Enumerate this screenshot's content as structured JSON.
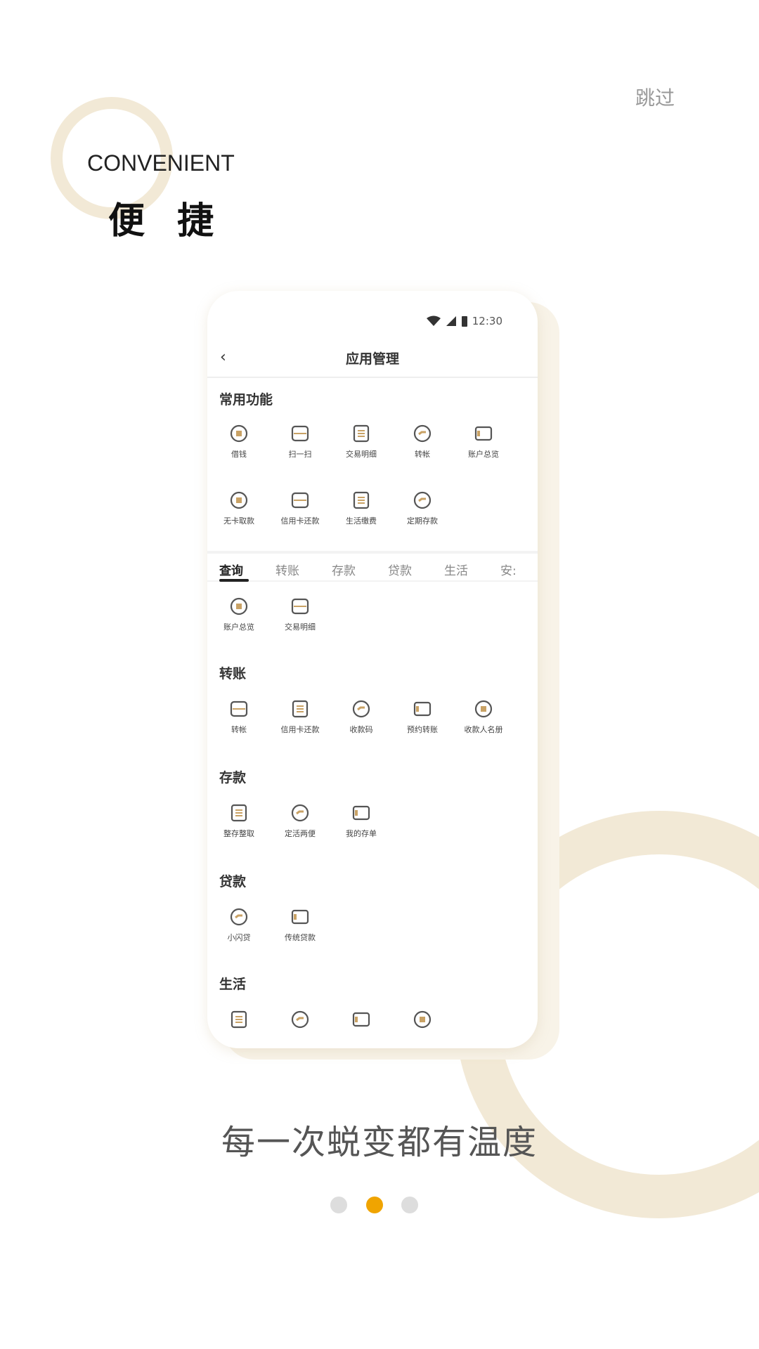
{
  "skip_label": "跳过",
  "heading_en": "CONVENIENT",
  "heading_cn": "便 捷",
  "tagline": "每一次蜕变都有温度",
  "pagination": {
    "total": 3,
    "active": 2
  },
  "colors": {
    "accent": "#f0a400",
    "ring": "#f2e9d6",
    "icon_gold": "#c9a265"
  },
  "phone": {
    "time": "12:30",
    "title": "应用管理",
    "common": {
      "title": "常用功能",
      "items": [
        "借钱",
        "扫一扫",
        "交易明细",
        "转帐",
        "账户总览",
        "无卡取款",
        "信用卡还款",
        "生活缴费",
        "定期存款"
      ]
    },
    "tabs": [
      "查询",
      "转账",
      "存款",
      "贷款",
      "生活",
      "安:"
    ],
    "sections": [
      {
        "title": "",
        "items": [
          "账户总览",
          "交易明细"
        ]
      },
      {
        "title": "转账",
        "items": [
          "转帐",
          "信用卡还款",
          "收款码",
          "预约转账",
          "收款人名册"
        ]
      },
      {
        "title": "存款",
        "items": [
          "整存整取",
          "定活两便",
          "我的存单"
        ]
      },
      {
        "title": "贷款",
        "items": [
          "小闪贷",
          "传统贷款"
        ]
      },
      {
        "title": "生活",
        "items": []
      }
    ]
  }
}
